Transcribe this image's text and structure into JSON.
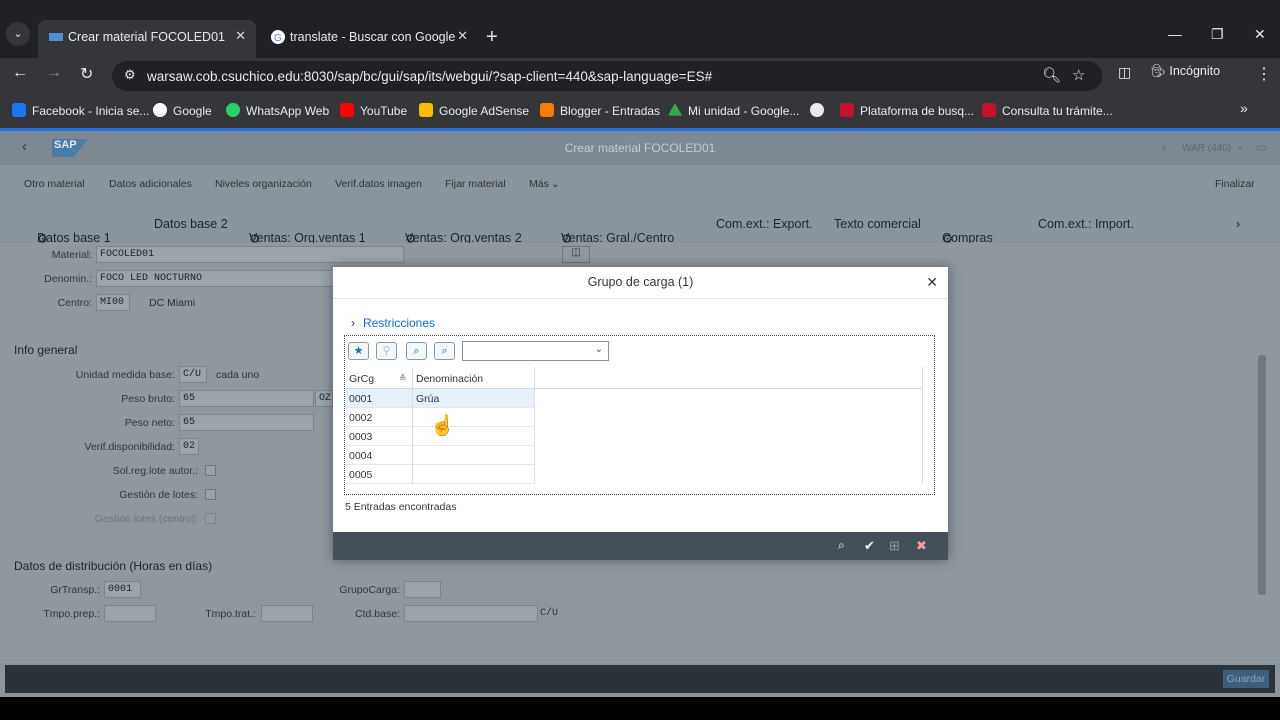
{
  "browser": {
    "tabs": [
      {
        "title": "Crear material FOCOLED01",
        "active": true
      },
      {
        "title": "translate - Buscar con Google",
        "active": false
      }
    ],
    "url": "warsaw.cob.csuchico.edu:8030/sap/bc/gui/sap/its/webgui/?sap-client=440&sap-language=ES#",
    "incognito_label": "Incógnito",
    "bookmarks": [
      {
        "label": "Facebook - Inicia se...",
        "color": "#1877f2"
      },
      {
        "label": "Google",
        "color": "#ffffff"
      },
      {
        "label": "WhatsApp Web",
        "color": "#25d366"
      },
      {
        "label": "YouTube",
        "color": "#ff0000"
      },
      {
        "label": "Google AdSense",
        "color": "#fbbc04"
      },
      {
        "label": "Blogger - Entradas",
        "color": "#f57d00"
      },
      {
        "label": "Mi unidad - Google...",
        "color": "#34a853"
      },
      {
        "label": "",
        "color": "#e8eaed"
      },
      {
        "label": "Plataforma de busq...",
        "color": "#c8102e"
      },
      {
        "label": "Consulta tu trámite...",
        "color": "#c8102e"
      }
    ]
  },
  "sap": {
    "title": "Crear material FOCOLED01",
    "logo": "SAP",
    "system": "WAR (440)",
    "appbar": [
      "Otro material",
      "Datos adicionales",
      "Niveles organización",
      "Verif.datos imagen",
      "Fijar material",
      "Más"
    ],
    "finish": "Finalizar",
    "tabs": [
      "Datos base 1",
      "Datos base 2",
      "Ventas: Org.ventas 1",
      "Ventas: Org.ventas 2",
      "Ventas: Gral./Centro",
      "Com.ext.: Export.",
      "Texto comercial",
      "Compras",
      "Com.ext.: Import."
    ],
    "form": {
      "material_label": "Material:",
      "material_value": "FOCOLED01",
      "denom_label": "Denomin.:",
      "denom_value": "FOCO LED NOCTURNO",
      "centro_label": "Centro:",
      "centro_value": "MI00",
      "centro_desc": "DC Miami",
      "info_general": "Info general",
      "unidad_label": "Unidad medida base:",
      "unidad_value": "C/U",
      "unidad_desc": "cada uno",
      "peso_bruto_label": "Peso bruto:",
      "peso_bruto_value": "65",
      "peso_unit": "OZ",
      "peso_neto_label": "Peso neto:",
      "peso_neto_value": "65",
      "verif_label": "Verif.disponibilidad:",
      "verif_value": "02",
      "solreg_label": "Sol.reg.lote autor.:",
      "gestion_label": "Gestión de lotes:",
      "gestion_centro_label": "Gestión lotes (centro):",
      "distrib_title": "Datos de distribución (Horas en días)",
      "grtransp_label": "GrTransp.:",
      "grtransp_value": "0001",
      "grupocarga_label": "GrupoCarga:",
      "tmpoprep_label": "Tmpo.prep.:",
      "tmpotrat_label": "Tmpo.trat.:",
      "ctdbase_label": "Ctd.base:",
      "ctdbase_unit": "C/U"
    },
    "save": "Guardar"
  },
  "dialog": {
    "title": "Grupo de carga (1)",
    "restrictions": "Restricciones",
    "columns": [
      "GrCg",
      "Denominación"
    ],
    "rows": [
      {
        "code": "0001",
        "name": "Grúa"
      },
      {
        "code": "0002",
        "name": ""
      },
      {
        "code": "0003",
        "name": ""
      },
      {
        "code": "0004",
        "name": ""
      },
      {
        "code": "0005",
        "name": ""
      }
    ],
    "count_text": "5 Entradas encontradas"
  }
}
